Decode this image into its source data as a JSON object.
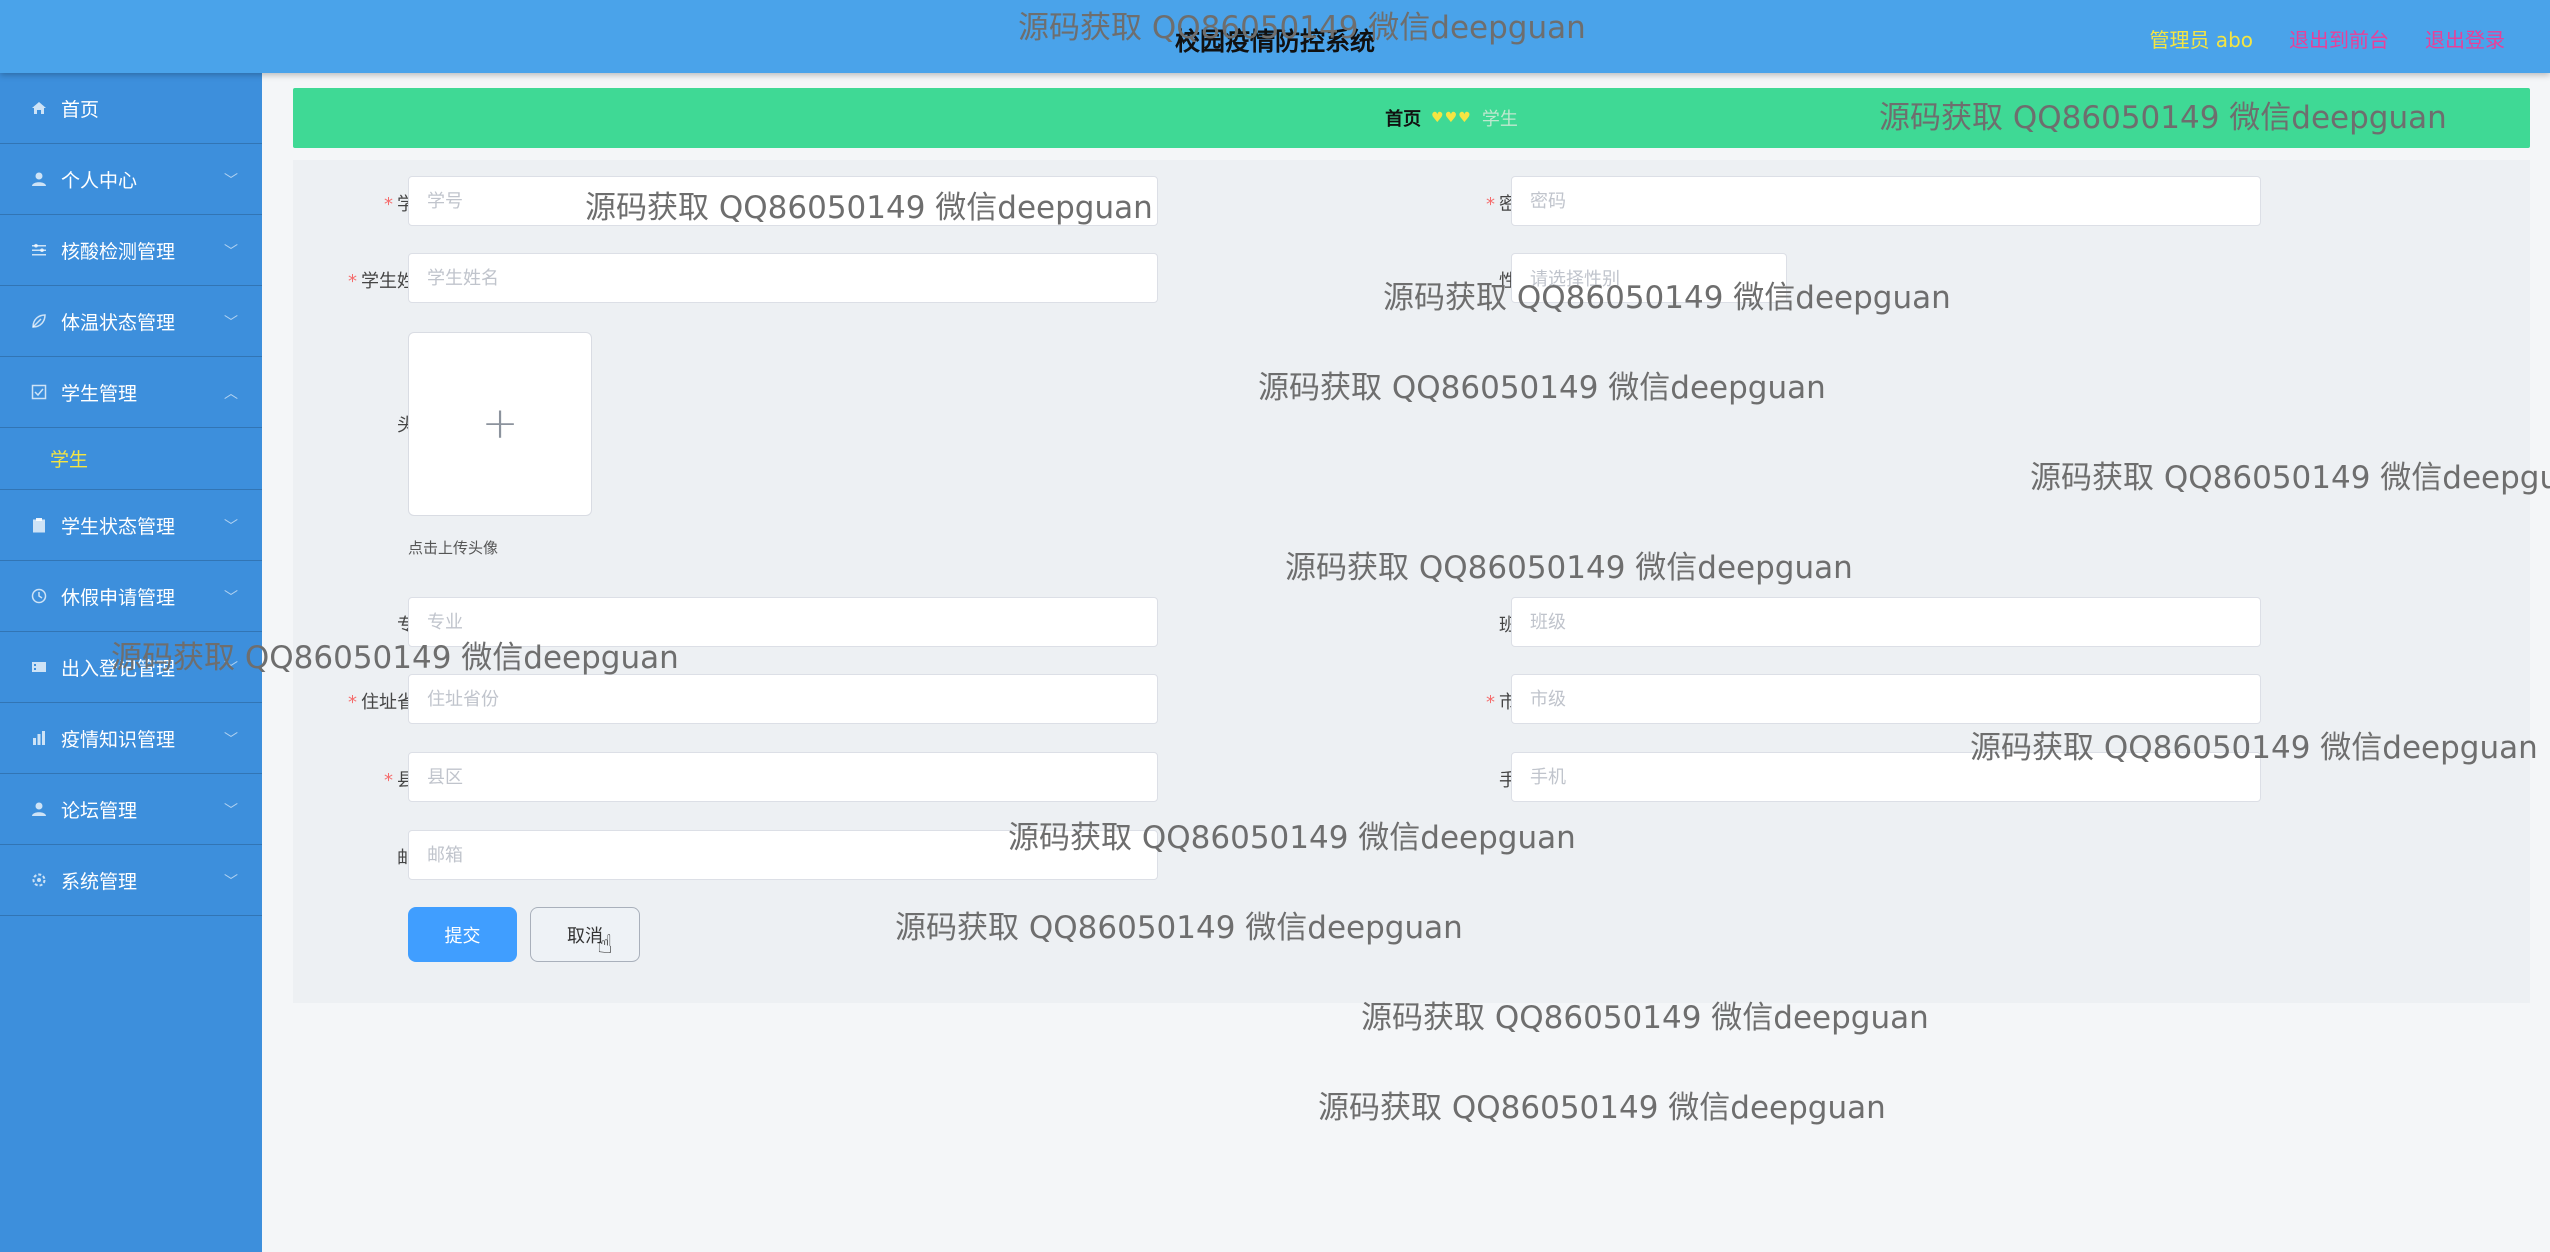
{
  "header": {
    "title": "校园疫情防控系统",
    "admin_label": "管理员 abo",
    "back_to_front": "退出到前台",
    "logout": "退出登录"
  },
  "sidebar": {
    "items": [
      {
        "label": "首页",
        "icon": "home-icon"
      },
      {
        "label": "个人中心",
        "icon": "user-icon"
      },
      {
        "label": "核酸检测管理",
        "icon": "sliders-icon"
      },
      {
        "label": "体温状态管理",
        "icon": "leaf-icon"
      },
      {
        "label": "学生管理",
        "icon": "check-square-icon"
      },
      {
        "label": "学生",
        "icon": ""
      },
      {
        "label": "学生状态管理",
        "icon": "clipboard-icon"
      },
      {
        "label": "休假申请管理",
        "icon": "clock-icon"
      },
      {
        "label": "出入登记管理",
        "icon": "film-icon"
      },
      {
        "label": "疫情知识管理",
        "icon": "chart-icon"
      },
      {
        "label": "论坛管理",
        "icon": "user-icon"
      },
      {
        "label": "系统管理",
        "icon": "gear-icon"
      }
    ]
  },
  "breadcrumb": {
    "home": "首页",
    "separator": "♥♥♥",
    "current": "学生"
  },
  "form": {
    "student_id": {
      "label": "学号",
      "placeholder": "学号",
      "required": "*"
    },
    "password": {
      "label": "密码",
      "placeholder": "密码",
      "required": "*"
    },
    "student_name": {
      "label": "学生姓名",
      "placeholder": "学生姓名",
      "required": "*"
    },
    "gender": {
      "label": "性别",
      "placeholder": "请选择性别"
    },
    "avatar": {
      "label": "头像",
      "plus": "+",
      "tip": "点击上传头像"
    },
    "major": {
      "label": "专业",
      "placeholder": "专业"
    },
    "class": {
      "label": "班级",
      "placeholder": "班级"
    },
    "province": {
      "label": "住址省份",
      "placeholder": "住址省份",
      "required": "*"
    },
    "city": {
      "label": "市级",
      "placeholder": "市级",
      "required": "*"
    },
    "district": {
      "label": "县区",
      "placeholder": "县区",
      "required": "*"
    },
    "phone": {
      "label": "手机",
      "placeholder": "手机"
    },
    "email": {
      "label": "邮箱",
      "placeholder": "邮箱"
    },
    "submit": "提交",
    "cancel": "取消"
  },
  "watermark": "源码获取 QQ86050149 微信deepguan"
}
